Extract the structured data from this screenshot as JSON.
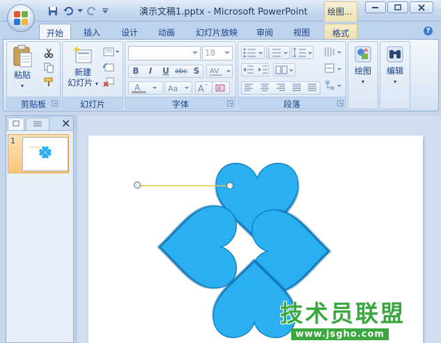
{
  "window": {
    "title": "演示文稿1.pptx - Microsoft PowerPoint",
    "context_tab_group": "绘图..."
  },
  "ribbon_tabs": [
    {
      "label": "开始",
      "active": true
    },
    {
      "label": "插入"
    },
    {
      "label": "设计"
    },
    {
      "label": "动画"
    },
    {
      "label": "幻灯片放映"
    },
    {
      "label": "审阅"
    },
    {
      "label": "视图"
    },
    {
      "label": "格式"
    }
  ],
  "groups": {
    "clipboard": {
      "label": "剪贴板",
      "paste": "粘贴"
    },
    "slides": {
      "label": "幻灯片",
      "new_slide_line1": "新建",
      "new_slide_line2": "幻灯片"
    },
    "font": {
      "label": "字体",
      "font_name": "",
      "font_size": "18"
    },
    "paragraph": {
      "label": "段落"
    },
    "drawing": {
      "label": "绘图"
    },
    "editing": {
      "label": "编辑"
    }
  },
  "slides_panel": {
    "thumbnails": [
      {
        "number": "1"
      }
    ]
  },
  "watermark": {
    "title": "技术员联盟",
    "url": "www.jsgho.com"
  },
  "colors": {
    "heart_fill": "#29aff0",
    "heart_edge": "#1282c6",
    "connector_line": "#e6c252",
    "watermark_green": "#3aa83e"
  }
}
